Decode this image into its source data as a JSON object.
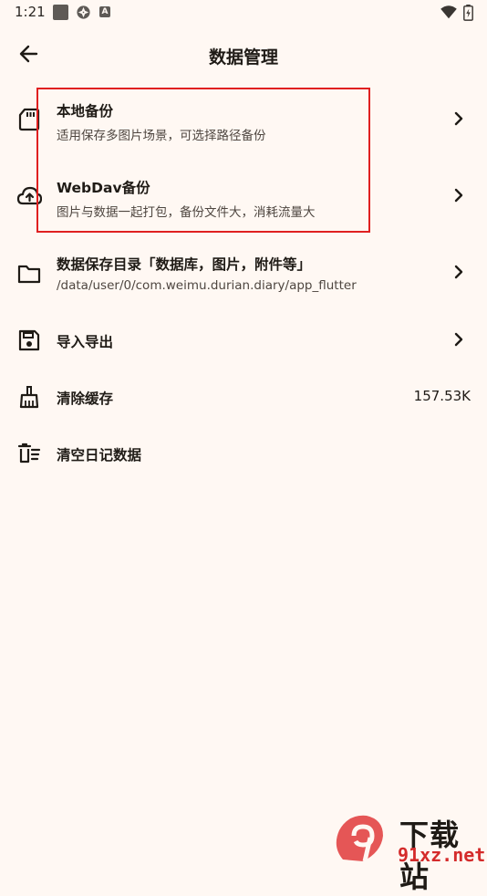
{
  "status_bar": {
    "time": "1:21",
    "icons": [
      "square-notification-icon",
      "aperture-icon",
      "a-icon",
      "wifi-icon",
      "battery-icon"
    ],
    "a_glyph": "A"
  },
  "header": {
    "title": "数据管理",
    "back_icon": "arrow-left-icon"
  },
  "items": [
    {
      "icon": "sd-card-icon",
      "title": "本地备份",
      "subtitle": "适用保存多图片场景，可选择路径备份",
      "chevron": true
    },
    {
      "icon": "cloud-upload-icon",
      "title": "WebDav备份",
      "subtitle": "图片与数据一起打包，备份文件大，消耗流量大",
      "chevron": true
    },
    {
      "icon": "folder-icon",
      "title": "数据保存目录「数据库，图片，附件等」",
      "subtitle": "/data/user/0/com.weimu.durian.diary/app_flutter",
      "chevron": true
    },
    {
      "icon": "save-icon",
      "title": "导入导出",
      "chevron": true
    },
    {
      "icon": "broom-icon",
      "title": "清除缓存",
      "trailing": "157.53K"
    },
    {
      "icon": "delete-list-icon",
      "title": "清空日记数据"
    }
  ],
  "watermark": {
    "text": "下载站",
    "url": "91xz.net"
  },
  "colors": {
    "background": "#fff8f3",
    "highlight": "#e02020",
    "text_primary": "#1f1b16",
    "text_secondary": "#4e4640"
  }
}
